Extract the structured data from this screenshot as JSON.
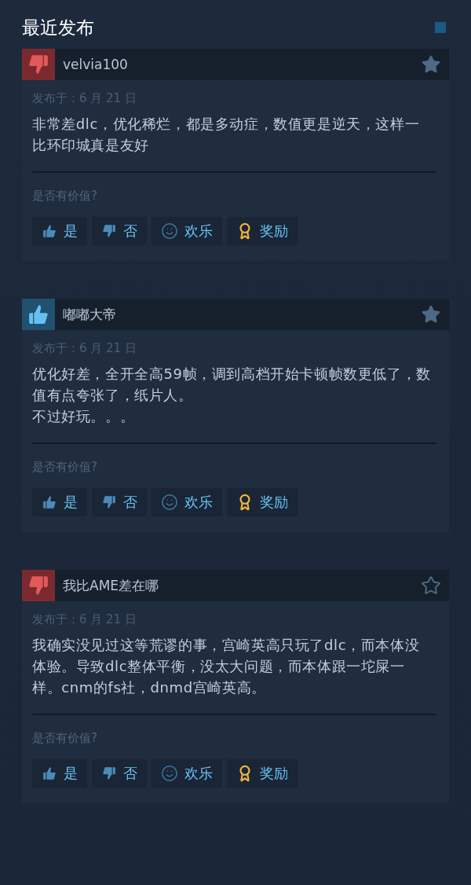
{
  "section_title": "最近发布",
  "reviews": [
    {
      "recommended": false,
      "author": "velvia100",
      "starred": true,
      "date": "发布于：6 月 21 日",
      "text": "非常差dlc，优化稀烂，都是多动症，数值更是逆天，这样一比环印城真是友好",
      "question": "是否有价值?",
      "buttons": [
        {
          "kind": "yes",
          "label": "是"
        },
        {
          "kind": "no",
          "label": "否"
        },
        {
          "kind": "funny",
          "label": "欢乐"
        },
        {
          "kind": "award",
          "label": "奖励"
        }
      ]
    },
    {
      "recommended": true,
      "author": "嘟嘟大帝",
      "starred": true,
      "date": "发布于：6 月 21 日",
      "text": "优化好差，全开全高59帧，调到高档开始卡顿帧数更低了，数值有点夸张了，纸片人。",
      "extra_text": "不过好玩。。。",
      "question": "是否有价值?",
      "buttons": [
        {
          "kind": "yes",
          "label": "是"
        },
        {
          "kind": "no",
          "label": "否"
        },
        {
          "kind": "funny",
          "label": "欢乐"
        },
        {
          "kind": "award",
          "label": "奖励"
        }
      ]
    },
    {
      "recommended": false,
      "author": "我比AME差在哪",
      "starred": false,
      "date": "发布于：6 月 21 日",
      "text": "我确实没见过这等荒谬的事，宫崎英高只玩了dlc，而本体没体验。导致dlc整体平衡，没太大问题，而本体跟一坨屎一样。cnm的fs社，dnmd宫崎英高。",
      "question": "是否有价值?",
      "buttons": [
        {
          "kind": "yes",
          "label": "是"
        },
        {
          "kind": "no",
          "label": "否"
        },
        {
          "kind": "funny",
          "label": "欢乐"
        },
        {
          "kind": "award",
          "label": "奖励"
        }
      ]
    }
  ]
}
